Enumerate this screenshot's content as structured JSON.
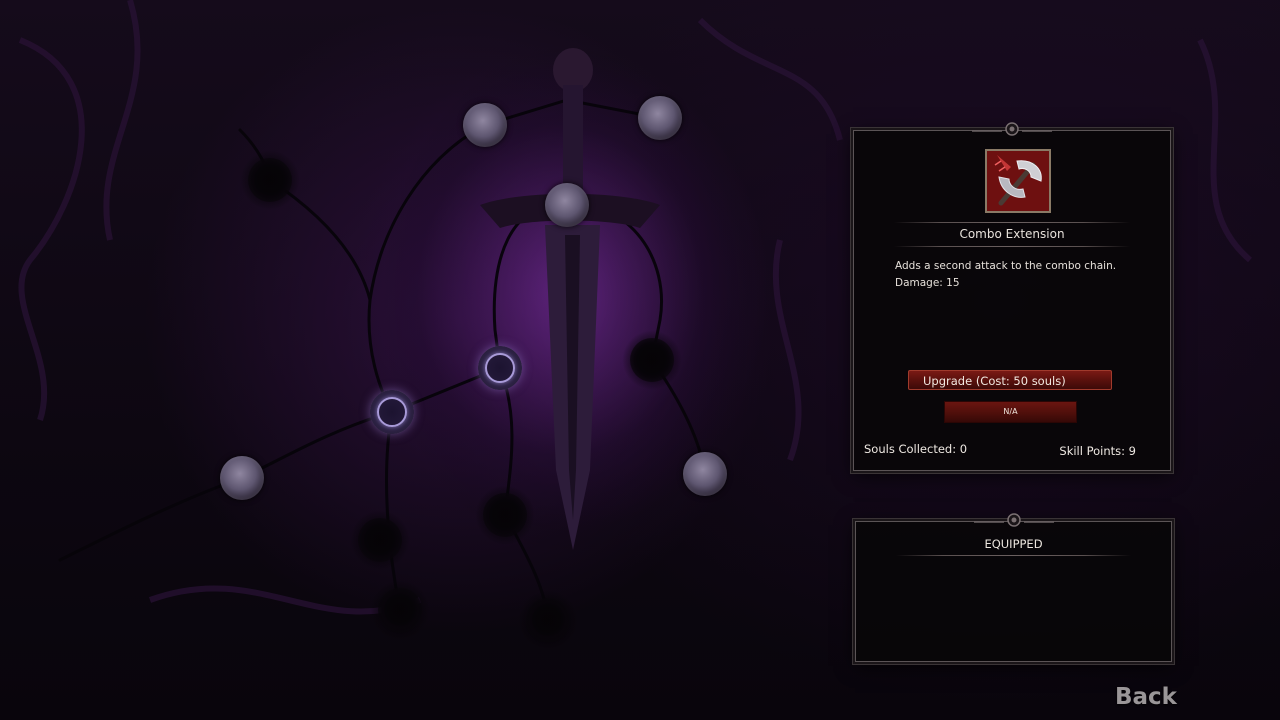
{
  "skill_tree": {
    "nodes": [
      {
        "id": "top-center",
        "state": "available"
      },
      {
        "id": "top-right",
        "state": "available"
      },
      {
        "id": "left-upper",
        "state": "locked"
      },
      {
        "id": "sword-guard",
        "state": "available"
      },
      {
        "id": "mid-center",
        "state": "unlocked"
      },
      {
        "id": "mid-right",
        "state": "locked"
      },
      {
        "id": "left-mid",
        "state": "unlocked"
      },
      {
        "id": "far-left",
        "state": "available"
      },
      {
        "id": "right-lower",
        "state": "available"
      },
      {
        "id": "lower-center",
        "state": "locked"
      },
      {
        "id": "lower-left",
        "state": "locked"
      },
      {
        "id": "bottom-left",
        "state": "locked"
      },
      {
        "id": "bottom-center",
        "state": "locked"
      }
    ]
  },
  "detail_panel": {
    "skill_icon": "crossed-axes-icon",
    "skill_name": "Combo Extension",
    "description_line1": "Adds a second attack to the combo chain.",
    "description_line2": "Damage: 15",
    "upgrade_label": "Upgrade (Cost: 50 souls)",
    "secondary_label": "N/A",
    "souls_collected": "Souls Collected: 0",
    "skill_points": "Skill Points: 9"
  },
  "equipped_panel": {
    "title": "EQUIPPED"
  },
  "navigation": {
    "back_label": "Back"
  },
  "colors": {
    "accent_purple": "#7a2ea0",
    "button_red": "#7a1a14",
    "panel_border": "#5b5456"
  }
}
